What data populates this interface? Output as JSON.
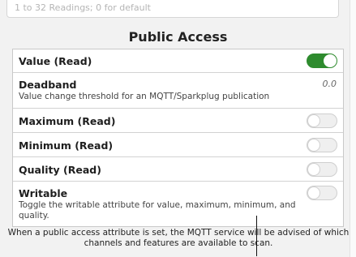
{
  "top_field": {
    "hint": "1 to 32 Readings; 0 for default"
  },
  "section": {
    "title": "Public Access"
  },
  "rows": [
    {
      "title": "Value (Read)",
      "toggle_on": true
    },
    {
      "title": "Deadband",
      "description": "Value change threshold for an MQTT/Sparkplug publication",
      "value": "0.0"
    },
    {
      "title": "Maximum (Read)",
      "toggle_on": false
    },
    {
      "title": "Minimum (Read)",
      "toggle_on": false
    },
    {
      "title": "Quality (Read)",
      "toggle_on": false
    },
    {
      "title": "Writable",
      "description": "Toggle the writable attribute for value, maximum, minimum, and quality.",
      "toggle_on": false
    }
  ],
  "footer": {
    "note": "When a public access attribute is set, the MQTT service will be advised of which channels and features are available to scan."
  },
  "colors": {
    "toggle_on": "#2e8b2e",
    "toggle_off": "#efefef"
  }
}
